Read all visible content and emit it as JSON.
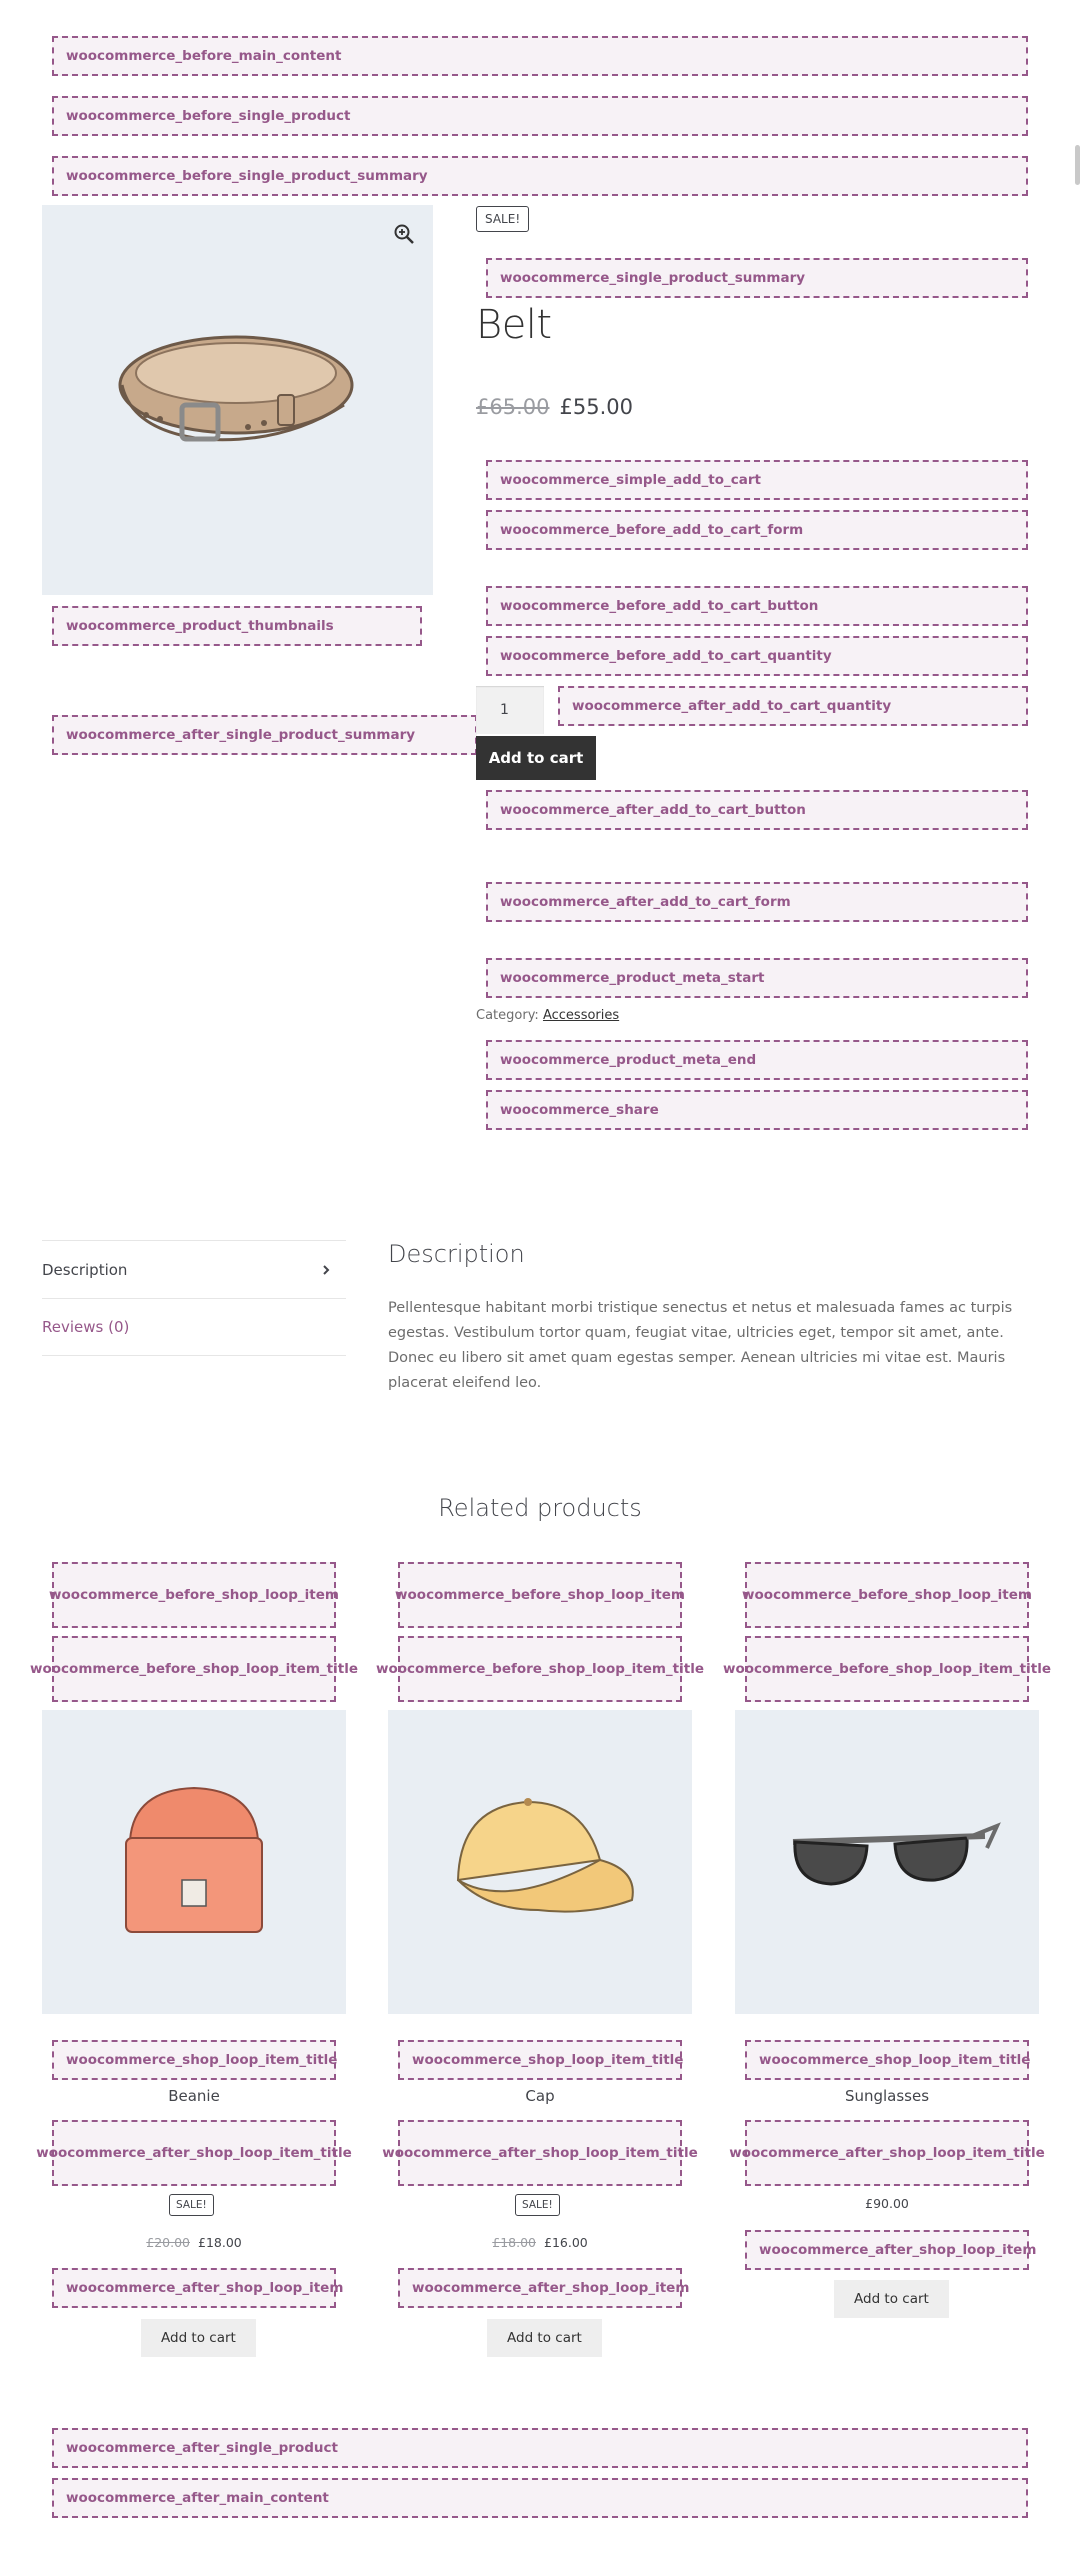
{
  "hooks": {
    "before_main_content": "woocommerce_before_main_content",
    "before_single_product": "woocommerce_before_single_product",
    "before_single_product_summary": "woocommerce_before_single_product_summary",
    "single_product_summary": "woocommerce_single_product_summary",
    "simple_add_to_cart": "woocommerce_simple_add_to_cart",
    "before_add_to_cart_form": "woocommerce_before_add_to_cart_form",
    "before_add_to_cart_button": "woocommerce_before_add_to_cart_button",
    "before_add_to_cart_quantity": "woocommerce_before_add_to_cart_quantity",
    "after_add_to_cart_quantity": "woocommerce_after_add_to_cart_quantity",
    "after_add_to_cart_button": "woocommerce_after_add_to_cart_button",
    "after_add_to_cart_form": "woocommerce_after_add_to_cart_form",
    "product_meta_start": "woocommerce_product_meta_start",
    "product_meta_end": "woocommerce_product_meta_end",
    "share": "woocommerce_share",
    "product_thumbnails": "woocommerce_product_thumbnails",
    "after_single_product_summary": "woocommerce_after_single_product_summary",
    "before_shop_loop_item": "woocommerce_before_shop_loop_item",
    "before_shop_loop_item_title": "woocommerce_before_shop_loop_item_title",
    "shop_loop_item_title": "woocommerce_shop_loop_item_title",
    "after_shop_loop_item_title": "woocommerce_after_shop_loop_item_title",
    "after_shop_loop_item": "woocommerce_after_shop_loop_item",
    "after_single_product": "woocommerce_after_single_product",
    "after_main_content": "woocommerce_after_main_content"
  },
  "product": {
    "sale_badge": "SALE!",
    "title": "Belt",
    "regular_price": "£65.00",
    "sale_price": "£55.00",
    "quantity": "1",
    "add_to_cart": "Add to cart",
    "category_label": "Category:",
    "category": "Accessories"
  },
  "tabs": {
    "description": "Description",
    "reviews": "Reviews (0)"
  },
  "description": {
    "title": "Description",
    "text": "Pellentesque habitant morbi tristique senectus et netus et malesuada fames ac turpis egestas. Vestibulum tortor quam, feugiat vitae, ultricies eget, tempor sit amet, ante. Donec eu libero sit amet quam egestas semper. Aenean ultricies mi vitae est. Mauris placerat eleifend leo."
  },
  "related": {
    "title": "Related products",
    "items": [
      {
        "name": "Beanie",
        "sale_badge": "SALE!",
        "regular_price": "£20.00",
        "price": "£18.00",
        "button": "Add to cart"
      },
      {
        "name": "Cap",
        "sale_badge": "SALE!",
        "regular_price": "£18.00",
        "price": "£16.00",
        "button": "Add to cart"
      },
      {
        "name": "Sunglasses",
        "price": "£90.00",
        "button": "Add to cart"
      }
    ]
  },
  "icons": {
    "zoom": "zoom-in-icon",
    "chevron": "chevron-right-icon"
  },
  "colors": {
    "hook_accent": "#96588a",
    "hook_background": "#f7f2f6",
    "image_background": "#e9eef3",
    "button_dark": "#333333"
  }
}
